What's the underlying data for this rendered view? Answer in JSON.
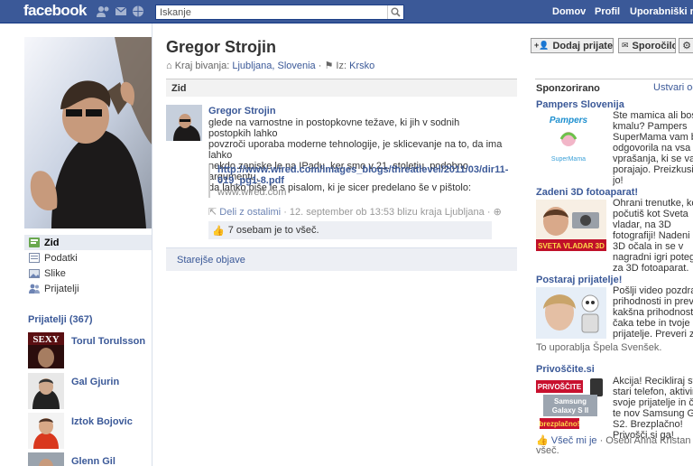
{
  "topbar": {
    "logo": "facebook",
    "search_placeholder": "Iskanje",
    "nav": [
      "Domov",
      "Profil",
      "Uporabniški rač"
    ]
  },
  "left": {
    "nav": [
      {
        "label": "Zid",
        "icon": "wall-icon",
        "selected": true
      },
      {
        "label": "Podatki",
        "icon": "info-icon"
      },
      {
        "label": "Slike",
        "icon": "photos-icon"
      },
      {
        "label": "Prijatelji",
        "icon": "friends-icon"
      }
    ],
    "friends_heading": "Prijatelji (367)",
    "friends": [
      {
        "name": "Torul Torulsson"
      },
      {
        "name": "Gal Gjurin"
      },
      {
        "name": "Iztok Bojovic"
      },
      {
        "name": "Glenn Gil"
      }
    ]
  },
  "profile": {
    "name": "Gregor Strojin",
    "lives_label": "Kraj bivanja:",
    "lives_value": "Ljubljana, Slovenia",
    "from_label": "Iz:",
    "from_value": "Krsko",
    "buttons": {
      "add_friend": "Dodaj prijatelja",
      "message": "Sporočilo"
    }
  },
  "wall": {
    "heading": "Zid",
    "post": {
      "author": "Gregor Strojin",
      "text_lines": [
        "glede na varnostne in postopkovne težave, ki jih v sodnih postopkih lahko",
        "povzroči uporaba moderne tehnologije, je sklicevanje na to, da ima lahko",
        "nekdo zapiske le na IPadu, ker smo v 21. stoletju, podobno argumentu,",
        "da lahko piše le s pisalom, ki je sicer predelano še v pištolo:"
      ],
      "link_lines": [
        "http://www.wired.com/images_blogs/threatlevel/2011/03/dir11-",
        "019_pg1-8.pdf"
      ],
      "link_domain": "www.wired.com",
      "share": "Deli z ostalimi",
      "timestamp": " · 12. september ob 13:53 blizu kraja Ljubljana · ",
      "likes": "7 osebam je to všeč."
    },
    "older_posts": "Starejše objave"
  },
  "sponsored": {
    "heading": "Sponzorirano",
    "create_ad": "Ustvari ogl",
    "ads": [
      {
        "title": "Pampers Slovenija",
        "text_lines": [
          "Ste mamica ali boste",
          "kmalu? Pampers",
          "SuperMama vam bo",
          "odgovorila na vsa",
          "vprašanja, ki se vam",
          "porajajo. Preizkusite",
          "jo!"
        ],
        "image_caption": "SuperMama",
        "image_brand": "Pampers"
      },
      {
        "title": "Zadeni 3D fotoaparat!",
        "text_lines": [
          "Ohrani trenutke, ko s",
          "počutiš kot Sveta",
          "vladar, na 3D",
          "fotografiji! Nadeni si",
          "3D očala in se v",
          "nagradni igri poteguj",
          "za 3D fotoaparat."
        ],
        "image_caption": "SVETA VLADAR 3D"
      },
      {
        "title": "Postaraj prijatelje!",
        "text_lines": [
          "Pošlji video pozdrave",
          "prihodnosti in prever",
          "kakšna prihodnost",
          "čaka tebe in tvoje",
          "prijatelje. Preveri zda"
        ],
        "social": "To uporablja Špela Svenšek."
      },
      {
        "title": "Privoščite.si",
        "text_lines": [
          "Akcija! Recikliraj svoj",
          "stari telefon, aktiviraj",
          "svoje prijatelje in čak",
          "te nov Samsung Gala",
          "S2. Brezplačno!",
          "Privošči.si ga!"
        ],
        "image_lines": [
          "PRIVOŠČITE",
          "Samsung",
          "Galaxy S II",
          "brezplačno!"
        ],
        "social_like": "Všeč mi je",
        "social_line1": " · Osebi Anna Kristan je to",
        "social_line2": "všeč."
      }
    ]
  },
  "colors": {
    "brand": "#3b5998",
    "link": "#3b5998",
    "panel": "#edeff4"
  }
}
